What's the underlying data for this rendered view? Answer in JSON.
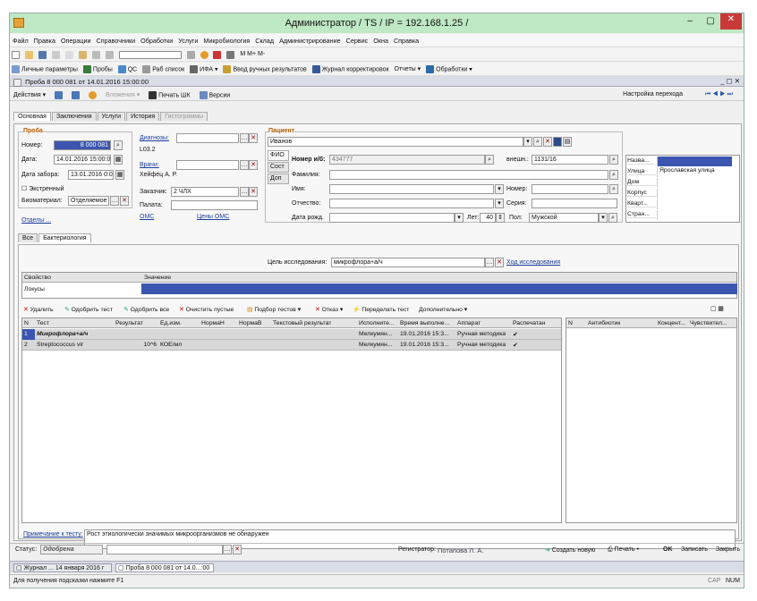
{
  "window": {
    "title": "Администратор / TS / IP = 192.168.1.25 /"
  },
  "menu": [
    "Файл",
    "Правка",
    "Операции",
    "Справочники",
    "Обработки",
    "Услуги",
    "Микробиология",
    "Склад",
    "Администрирование",
    "Сервис",
    "Окна",
    "Справка"
  ],
  "toolbar2": {
    "personal": "Личные параметры",
    "samples": "Пробы",
    "qc": "QC",
    "worklist": "Раб список",
    "ifa": "ИФА",
    "manual": "Ввод ручных результатов",
    "journal": "Журнал корректировок",
    "reports": "Отчеты",
    "processing": "Обработки"
  },
  "doc": {
    "title": "Проба 8 000 081 от 14.01.2016 15:00:00",
    "actions": "Действия",
    "attachments": "Вложения",
    "print_barcode": "Печать ШК",
    "versions": "Версии",
    "nav_setting": "Настройка перехода"
  },
  "tabs": [
    "Основная",
    "Заключения",
    "Услуги",
    "История",
    "Гистограммы"
  ],
  "sample": {
    "group": "Проба",
    "number_label": "Номер:",
    "number": "8 000 081",
    "date_label": "Дата:",
    "date": "14.01.2016 15:00:00",
    "take_label": "Дата забора:",
    "take": "13.01.2016 0:00",
    "urgent": "Экстренный",
    "biomat_label": "Биоматериал:",
    "biomat": "Отделяемое ...",
    "departments": "Отделы ..."
  },
  "diag": {
    "label": "Диагнозы:",
    "code": "L03.2",
    "doctors_label": "Врачи:",
    "doctor": "Хейфец А. Р.",
    "customer_label": "Заказчик:",
    "customer": "2 ЧЛХ",
    "ward_label": "Палата:",
    "oms": "ОМС",
    "oms_prices": "Цены ОМС"
  },
  "patient": {
    "group": "Пациент",
    "name": "Иванов",
    "side_tabs": [
      "ФИО",
      "Сост",
      "Доп"
    ],
    "card_label": "Номер и/б:",
    "card": "434777",
    "ext_label": "внешн.:",
    "ext": "1131/16",
    "surname_label": "Фамилия:",
    "name_label": "Имя:",
    "number_label": "Номер:",
    "patronymic_label": "Отчество:",
    "series_label": "Серия:",
    "dob_label": "Дата рожд.",
    "age_label": "Лет:",
    "age": "40",
    "sex_label": "Пол:",
    "sex": "Мужской"
  },
  "address": {
    "rows": [
      [
        "Назва...",
        ""
      ],
      [
        "Улица",
        "Ярославская улица"
      ],
      [
        "Дом",
        ""
      ],
      [
        "Корпус",
        ""
      ],
      [
        "Кварт...",
        ""
      ],
      [
        "Стран...",
        ""
      ]
    ]
  },
  "inner_tabs": [
    "Все",
    "Бактериология"
  ],
  "research": {
    "label": "Цель исследования:",
    "value": "микрофлора+а/ч",
    "progress": "Ход исследования"
  },
  "props": {
    "h1": "Свойство",
    "h2": "Значение",
    "row": "Локусы"
  },
  "testbar": {
    "delete": "Удалить",
    "approve": "Одобрить тест",
    "approve_all": "Одобрить все",
    "clear": "Очистить пустые",
    "select": "Подбор тестов",
    "refuse": "Отказ",
    "redo": "Переделать тест",
    "more": "Дополнительно"
  },
  "table": {
    "headers": [
      "N",
      "Тест",
      "Результат",
      "Ед.изм.",
      "НормаН",
      "НормаВ",
      "Текстовый результат",
      "Исполните...",
      "Время выполне...",
      "Аппарат",
      "Распечатан"
    ],
    "rows": [
      [
        "1",
        "Микрофлора+а/ч",
        "",
        "",
        "",
        "",
        "",
        "Мелкумян...",
        "19.01.2016 15:3...",
        "Ручная методика",
        "✔"
      ],
      [
        "2",
        "Streptococcus vir",
        "10^6",
        "КОЕ/мл",
        "",
        "",
        "",
        "Мелкумян...",
        "19.01.2016 15:3...",
        "Ручная методика",
        "✔"
      ]
    ]
  },
  "abtable": {
    "headers": [
      "N",
      "Антибиотик",
      "Концент...",
      "Чувствител..."
    ]
  },
  "note": {
    "label": "Примечание к тесту:",
    "value": "Рост этиологически значимых микроорганизмов не обнаружен"
  },
  "status": {
    "label": "Статус:",
    "value": "Одобрена",
    "registrar_label": "Регистратор:",
    "registrar": "Потапова Л. А.",
    "create": "Создать новую",
    "print": "Печать",
    "ok": "OK",
    "save": "Записать",
    "close": "Закрыть"
  },
  "taskbar": [
    "Журнал ... 14 января 2016 г",
    "Проба 8 000 081 от 14.0...:00"
  ],
  "hint": {
    "text": "Для получения подсказки нажмите F1",
    "cap": "CAP",
    "num": "NUM"
  }
}
